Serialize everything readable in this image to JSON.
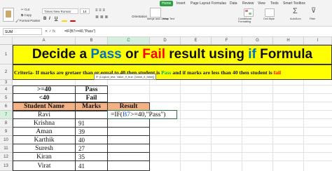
{
  "ribbon": {
    "tabs": [
      {
        "label": "Home",
        "active": true
      },
      {
        "label": "Insert"
      },
      {
        "label": "Page Layout"
      },
      {
        "label": "Formulas"
      },
      {
        "label": "Data"
      },
      {
        "label": "Review"
      },
      {
        "label": "View"
      },
      {
        "label": "Tools"
      },
      {
        "label": "Smart Toolbox"
      }
    ],
    "cut_label": "Cut",
    "copy_label": "Copy",
    "format_painter_label": "Format Painter",
    "font_name": "Times New Roman",
    "font_size": "14",
    "bold_glyph": "B",
    "italic_glyph": "I",
    "underline_glyph": "U",
    "orientation_label": "Orientation",
    "merge_label": "Merge and Center",
    "wrap_label": "Wrap Text",
    "conditional_label": "Conditional Formatting",
    "cell_style_label": "Cell Style",
    "autosum_label": "AutoSum",
    "filter_label": "Filter"
  },
  "formula_bar": {
    "name_box": "SUM",
    "icons": "✕ ✓ fx",
    "formula": "=IF(B7>=40,\"Pass\")"
  },
  "columns": [
    "A",
    "B",
    "C",
    "D",
    "E",
    "F",
    "G",
    "H",
    "I"
  ],
  "rows": [
    "1",
    "2",
    "3",
    "4",
    "5",
    "6",
    "7",
    "8",
    "9",
    "10",
    "11",
    "12",
    "13"
  ],
  "sheet": {
    "title_parts": [
      "Decide a ",
      "Pass",
      " or ",
      "Fail",
      " result using ",
      "if",
      " Formula"
    ],
    "criteria_parts": [
      "Criteria- If marks are gretaer than or equal to 40 then student is ",
      "Pass",
      " and if marks are less than 40 then student is ",
      "fail"
    ],
    "rule_rows": [
      {
        "condition": ">=40",
        "result": "Pass"
      },
      {
        "condition": "<40",
        "result": "Fail"
      }
    ],
    "headers": {
      "name": "Student Name",
      "marks": "Marks",
      "result": "Result"
    },
    "edit_cell": {
      "prefix": "=IF(",
      "ref": "B7",
      "suffix": ">=40,\"Pass\")"
    },
    "students": [
      {
        "name": "Ravi",
        "marks": ""
      },
      {
        "name": "Krishna",
        "marks": "91"
      },
      {
        "name": "Aman",
        "marks": "39"
      },
      {
        "name": "Karthik",
        "marks": "40"
      },
      {
        "name": "Suresh",
        "marks": "27"
      },
      {
        "name": "Kiran",
        "marks": "35"
      },
      {
        "name": "Virat",
        "marks": "41"
      }
    ],
    "tooltip": "IF (Logical_test, Value_if_true, [Value_if_false])"
  },
  "colors": {
    "title_bg": "#ffff00",
    "header_bg": "#f4b183",
    "pass_green": "#00b050",
    "fail_red": "#ff0000",
    "if_blue": "#0070c0",
    "home_tab": "#2ea043"
  }
}
